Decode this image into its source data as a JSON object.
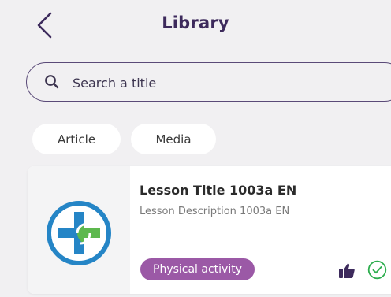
{
  "header": {
    "title": "Library"
  },
  "search": {
    "placeholder": "Search a title"
  },
  "filters": [
    {
      "label": "Article"
    },
    {
      "label": "Media"
    }
  ],
  "lessons": [
    {
      "title": "Lesson Title 1003a EN",
      "description": "Lesson Description 1003a EN",
      "tag": "Physical activity",
      "icons": [
        "thumbs-up-icon",
        "check-circle-icon"
      ]
    }
  ],
  "colors": {
    "title": "#3d2a5c",
    "tag_bg": "#9b59a6",
    "check": "#2eae4f",
    "logo_blue": "#2585c6",
    "logo_green": "#5db84e"
  }
}
